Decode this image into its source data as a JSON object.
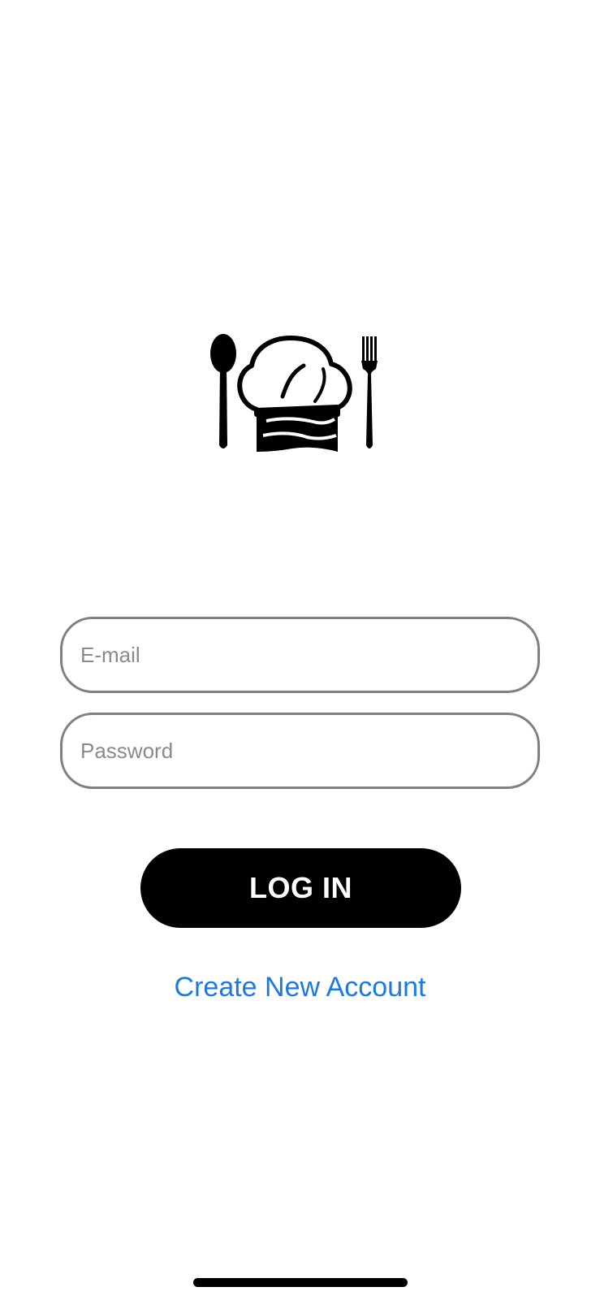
{
  "login": {
    "email_placeholder": "E-mail",
    "email_value": "",
    "password_placeholder": "Password",
    "password_value": "",
    "login_label": "LOG IN",
    "create_account_label": "Create New Account"
  },
  "logo": {
    "icon": "chef-hat-spoon-fork-icon"
  },
  "colors": {
    "link": "#1a7ae0",
    "button_bg": "#000000",
    "button_text": "#ffffff",
    "field_border": "#808080"
  }
}
